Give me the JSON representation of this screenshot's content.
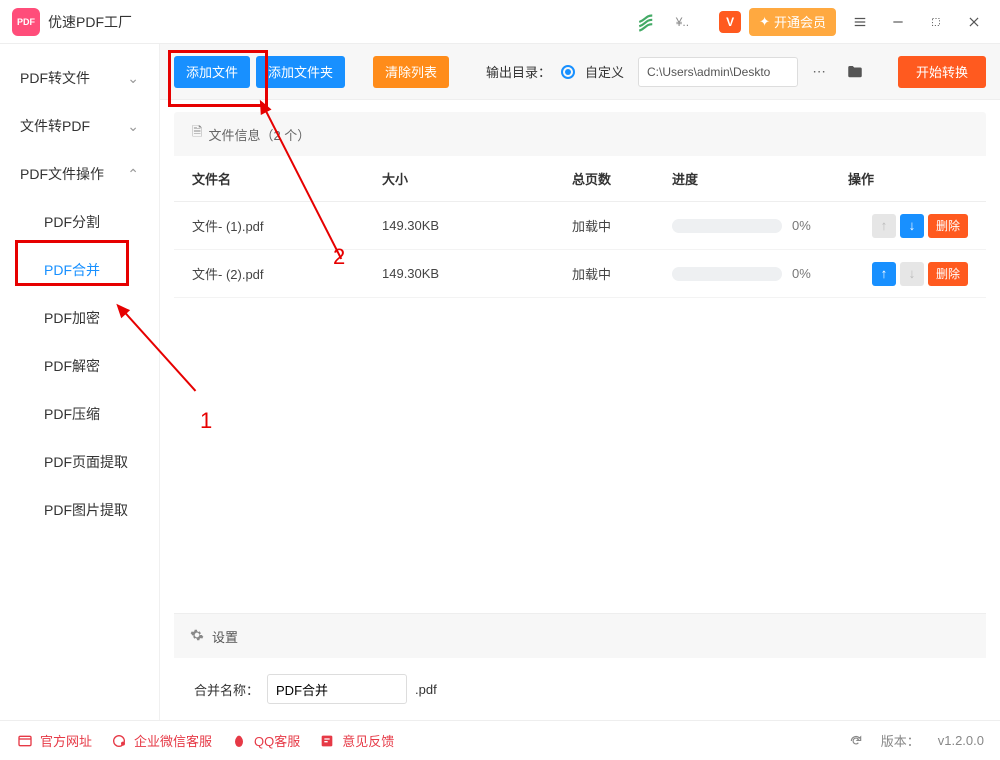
{
  "app": {
    "title": "优速PDF工厂"
  },
  "titlebar": {
    "vip_button": "开通会员"
  },
  "sidebar": {
    "groups": [
      {
        "label": "PDF转文件",
        "expanded": false
      },
      {
        "label": "文件转PDF",
        "expanded": false
      },
      {
        "label": "PDF文件操作",
        "expanded": true
      }
    ],
    "items": [
      "PDF分割",
      "PDF合并",
      "PDF加密",
      "PDF解密",
      "PDF压缩",
      "PDF页面提取",
      "PDF图片提取"
    ],
    "active_index": 1
  },
  "toolbar": {
    "add_file": "添加文件",
    "add_folder": "添加文件夹",
    "clear_list": "清除列表",
    "output_label": "输出目录：",
    "radio_custom": "自定义",
    "output_path": "C:\\Users\\admin\\Deskto",
    "start": "开始转换"
  },
  "file_info": {
    "header": "文件信息（2 个）",
    "columns": {
      "name": "文件名",
      "size": "大小",
      "pages": "总页数",
      "progress": "进度",
      "action": "操作"
    },
    "rows": [
      {
        "name": "文件- (1).pdf",
        "size": "149.30KB",
        "pages": "加载中",
        "pct": "0%",
        "up_enabled": false,
        "down_enabled": true
      },
      {
        "name": "文件- (2).pdf",
        "size": "149.30KB",
        "pages": "加载中",
        "pct": "0%",
        "up_enabled": true,
        "down_enabled": false
      }
    ],
    "delete_label": "删除"
  },
  "settings": {
    "title": "设置",
    "merge_name_label": "合并名称：",
    "merge_name_value": "PDF合并",
    "suffix": ".pdf"
  },
  "footer": {
    "site": "官方网址",
    "wecom": "企业微信客服",
    "qq": "QQ客服",
    "feedback": "意见反馈",
    "version_label": "版本：",
    "version": "v1.2.0.0"
  },
  "annotations": {
    "num1": "1",
    "num2": "2"
  }
}
